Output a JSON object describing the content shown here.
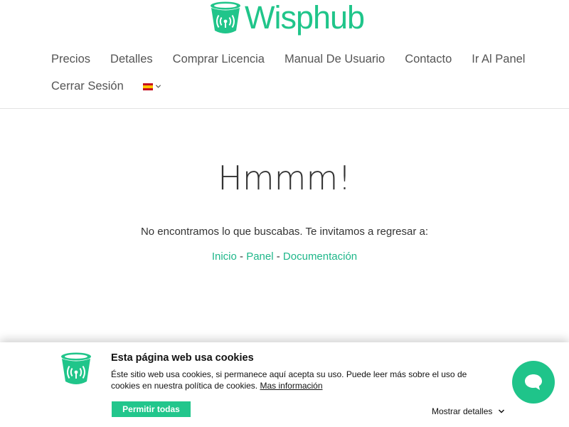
{
  "brand": {
    "name": "Wisphub",
    "color": "#20c58a"
  },
  "nav": {
    "row1": [
      "Precios",
      "Detalles",
      "Comprar Licencia",
      "Manual De Usuario",
      "Contacto",
      "Ir Al Panel"
    ],
    "row2": [
      "Cerrar Sesión"
    ],
    "language_flag": "spain-flag-icon"
  },
  "main": {
    "title": "Hmmm!",
    "subtitle": "No encontramos lo que buscabas. Te invitamos a regresar a:",
    "links": [
      "Inicio",
      "Panel",
      "Documentación"
    ],
    "separator": " - "
  },
  "cookie": {
    "title": "Esta página web usa cookies",
    "text": "Éste sitio web usa cookies, si permanece aquí acepta su uso. Puede leer más sobre el uso de cookies en nuestra política de cookies.",
    "more_link": "Mas información",
    "allow_label": "Permitir todas",
    "details_label": "Mostrar detalles",
    "accent": "#22c68c"
  },
  "chat": {
    "icon": "chat-bubble-icon",
    "color": "#1fc48a"
  }
}
